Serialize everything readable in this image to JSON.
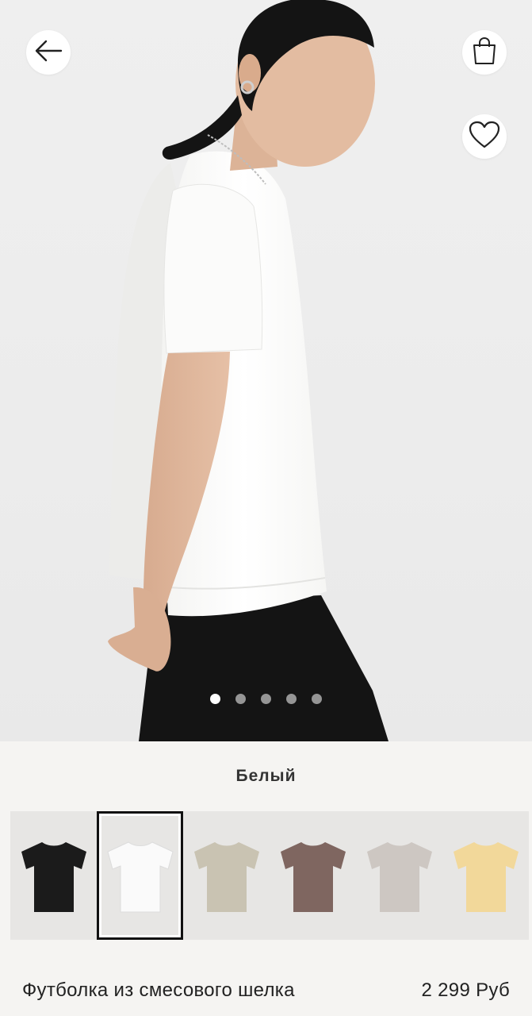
{
  "hero": {
    "carousel": {
      "count": 5,
      "active": 1
    }
  },
  "icons": {
    "back": "arrow-left-icon",
    "bag": "shopping-bag-icon",
    "favorite": "heart-icon"
  },
  "color": {
    "selected_name": "Белый",
    "swatches": [
      {
        "id": "black",
        "color": "#1b1b1b"
      },
      {
        "id": "white",
        "color": "#fafafa",
        "selected": true
      },
      {
        "id": "beige",
        "color": "#c9c3b2"
      },
      {
        "id": "brown",
        "color": "#7f6660"
      },
      {
        "id": "light-grey",
        "color": "#cdc7c2"
      },
      {
        "id": "yellow",
        "color": "#f2d89a"
      }
    ]
  },
  "product": {
    "name": "Футболка из смесового шелка",
    "price": "2 299 Руб"
  }
}
